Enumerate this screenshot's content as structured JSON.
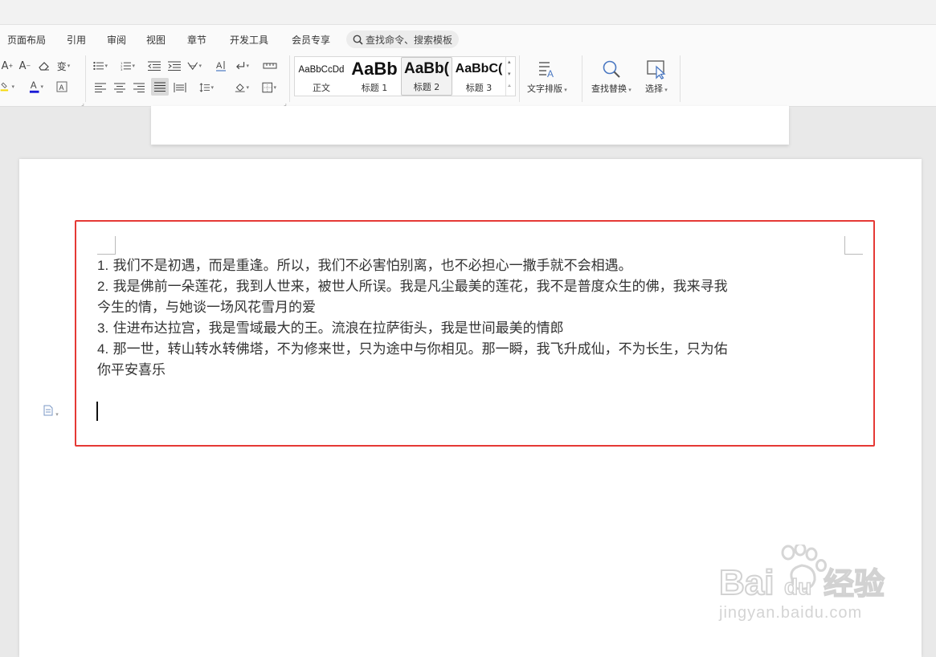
{
  "menu_tabs": [
    "页面布局",
    "引用",
    "审阅",
    "视图",
    "章节",
    "开发工具",
    "会员专享"
  ],
  "search": {
    "placeholder": "查找命令、搜索模板"
  },
  "style_gallery": [
    {
      "sample": "AaBbCcDd",
      "label": "正文"
    },
    {
      "sample": "AaBb",
      "label": "标题 1"
    },
    {
      "sample": "AaBb(",
      "label": "标题 2",
      "selected": true
    },
    {
      "sample": "AaBbC(",
      "label": "标题 3"
    }
  ],
  "ribbon": {
    "text_layout_label": "文字排版",
    "find_replace_label": "查找替换",
    "select_label": "选择"
  },
  "document": {
    "lines": [
      {
        "num": "1.",
        "text": "我们不是初遇，而是重逢。所以，我们不必害怕别离，也不必担心一撒手就不会相遇。"
      },
      {
        "num": "2.",
        "text": "我是佛前一朵莲花，我到人世来，被世人所误。我是凡尘最美的莲花，我不是普度众生的佛，我来寻我"
      },
      {
        "num": "",
        "text": "今生的情，与她谈一场风花雪月的爱"
      },
      {
        "num": "3.",
        "text": "住进布达拉宫，我是雪域最大的王。流浪在拉萨街头，我是世间最美的情郎"
      },
      {
        "num": "4.",
        "text": "那一世，转山转水转佛塔，不为修来世，只为途中与你相见。那一瞬，我飞升成仙，不为长生，只为佑"
      },
      {
        "num": "",
        "text": "你平安喜乐"
      }
    ]
  },
  "watermark": {
    "brand": "Bai",
    "brand_suffix": "du",
    "cn": "经验",
    "url": "jingyan.baidu.com"
  },
  "colors": {
    "highlight_border": "#e53935",
    "font_color_bar": "#1a1ad6",
    "highlighter": "#f5d90a"
  }
}
